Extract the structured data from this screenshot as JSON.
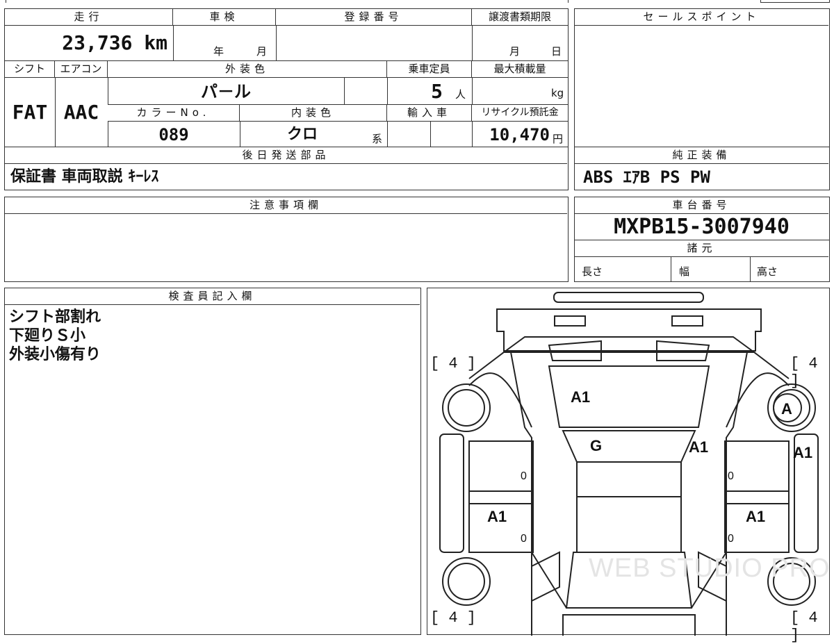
{
  "top_cut_marks": "",
  "mileage": {
    "header": "走行",
    "value": "23,736 km"
  },
  "shaken": {
    "header": "車検",
    "year_label": "年",
    "month_label": "月"
  },
  "registration": {
    "header": "登録番号"
  },
  "transfer_deadline": {
    "header": "譲渡書類期限",
    "month_label": "月",
    "day_label": "日"
  },
  "sales_point": {
    "header": "セールスポイント"
  },
  "shift": {
    "header": "シフト",
    "value": "FAT"
  },
  "aircon": {
    "header": "エアコン",
    "value": "AAC"
  },
  "exterior_color": {
    "header": "外装色",
    "value": "パ－ル"
  },
  "capacity": {
    "header": "乗車定員",
    "value": "5",
    "unit": "人"
  },
  "max_load": {
    "header": "最大積載量",
    "unit": "kg"
  },
  "color_no": {
    "header": "カラーNo.",
    "value": "089"
  },
  "interior_color": {
    "header": "内装色",
    "value": "クロ",
    "suffix": "系"
  },
  "import": {
    "header": "輸入車"
  },
  "recycle": {
    "header": "リサイクル預託金",
    "value": "10,470",
    "unit": "円"
  },
  "later_parts": {
    "header": "後日発送部品",
    "value": "保証書 車両取説 ｷｰﾚｽ"
  },
  "genuine_equipment": {
    "header": "純正装備",
    "value": "ABS ｴｱB PS PW"
  },
  "notes": {
    "header": "注意事項欄"
  },
  "chassis": {
    "header": "車台番号",
    "value": "MXPB15-3007940"
  },
  "specs": {
    "header": "諸元",
    "length": "長さ",
    "width": "幅",
    "height": "高さ"
  },
  "inspector": {
    "header": "検査員記入欄",
    "lines": [
      "シフト部割れ",
      "下廻りＳ小",
      "外装小傷有り"
    ]
  },
  "diagram": {
    "tire_fl": "[ 4 ]",
    "tire_fr": "[ 4 ]",
    "tire_rl": "[ 4 ]",
    "tire_rr": "[ 4 ]",
    "hood": "A1",
    "windshield": "G",
    "fender_right": "A1",
    "wheel_fr": "A",
    "right_side": "A1",
    "door_rl": "A1",
    "door_rr": "A1",
    "zero_1": "0",
    "zero_2": "0",
    "zero_3": "0",
    "zero_4": "0",
    "watermark": "WEB STUDIO PRO"
  }
}
